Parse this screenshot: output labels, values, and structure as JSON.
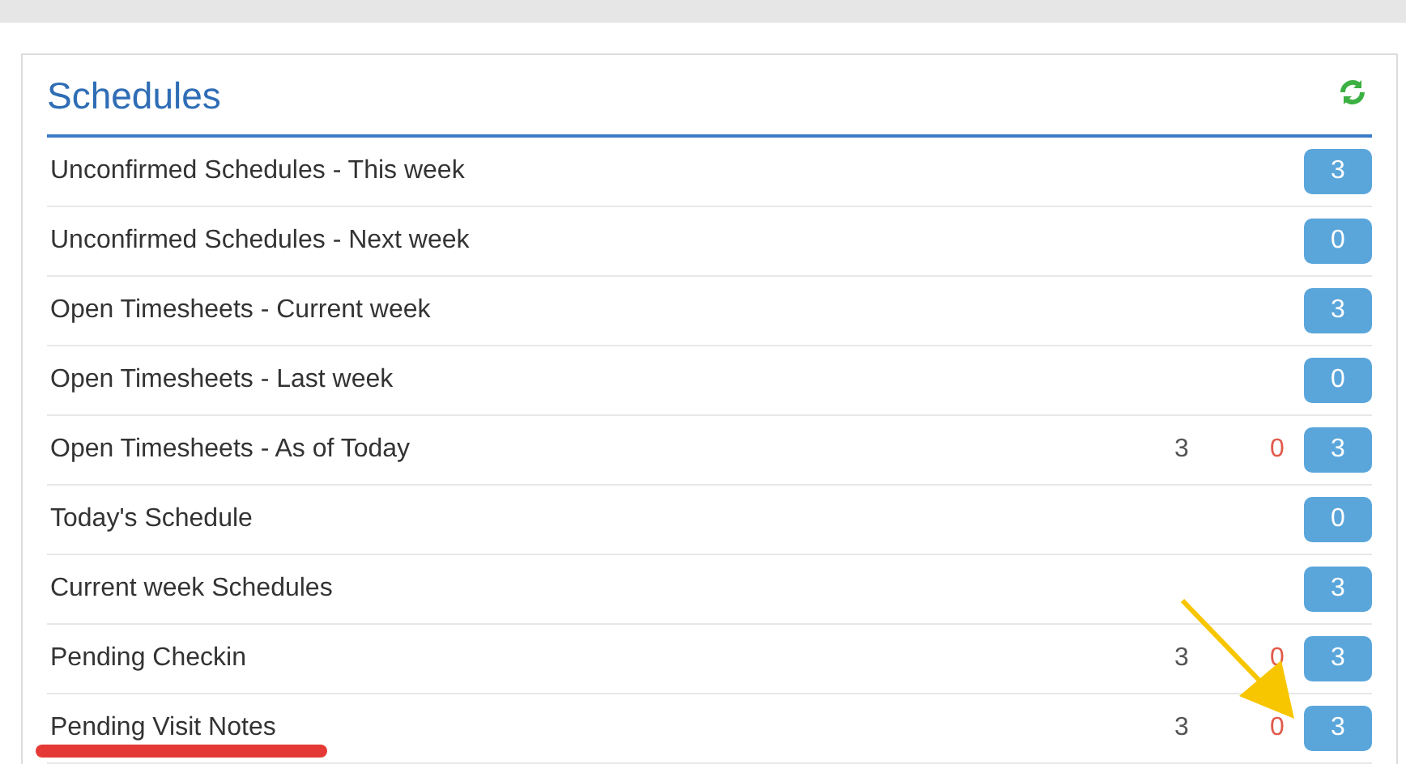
{
  "panel": {
    "title": "Schedules"
  },
  "rows": [
    {
      "label": "Unconfirmed Schedules - This week",
      "badge": "3"
    },
    {
      "label": "Unconfirmed Schedules - Next week",
      "badge": "0"
    },
    {
      "label": "Open Timesheets - Current week",
      "badge": "3"
    },
    {
      "label": "Open Timesheets - Last week",
      "badge": "0"
    },
    {
      "label": "Open Timesheets - As of Today",
      "count": "3",
      "alert": "0",
      "badge": "3"
    },
    {
      "label": "Today's Schedule",
      "badge": "0"
    },
    {
      "label": "Current week Schedules",
      "badge": "3"
    },
    {
      "label": "Pending Checkin",
      "count": "3",
      "alert": "0",
      "badge": "3"
    },
    {
      "label": "Pending Visit Notes",
      "count": "3",
      "alert": "0",
      "badge": "3"
    }
  ]
}
